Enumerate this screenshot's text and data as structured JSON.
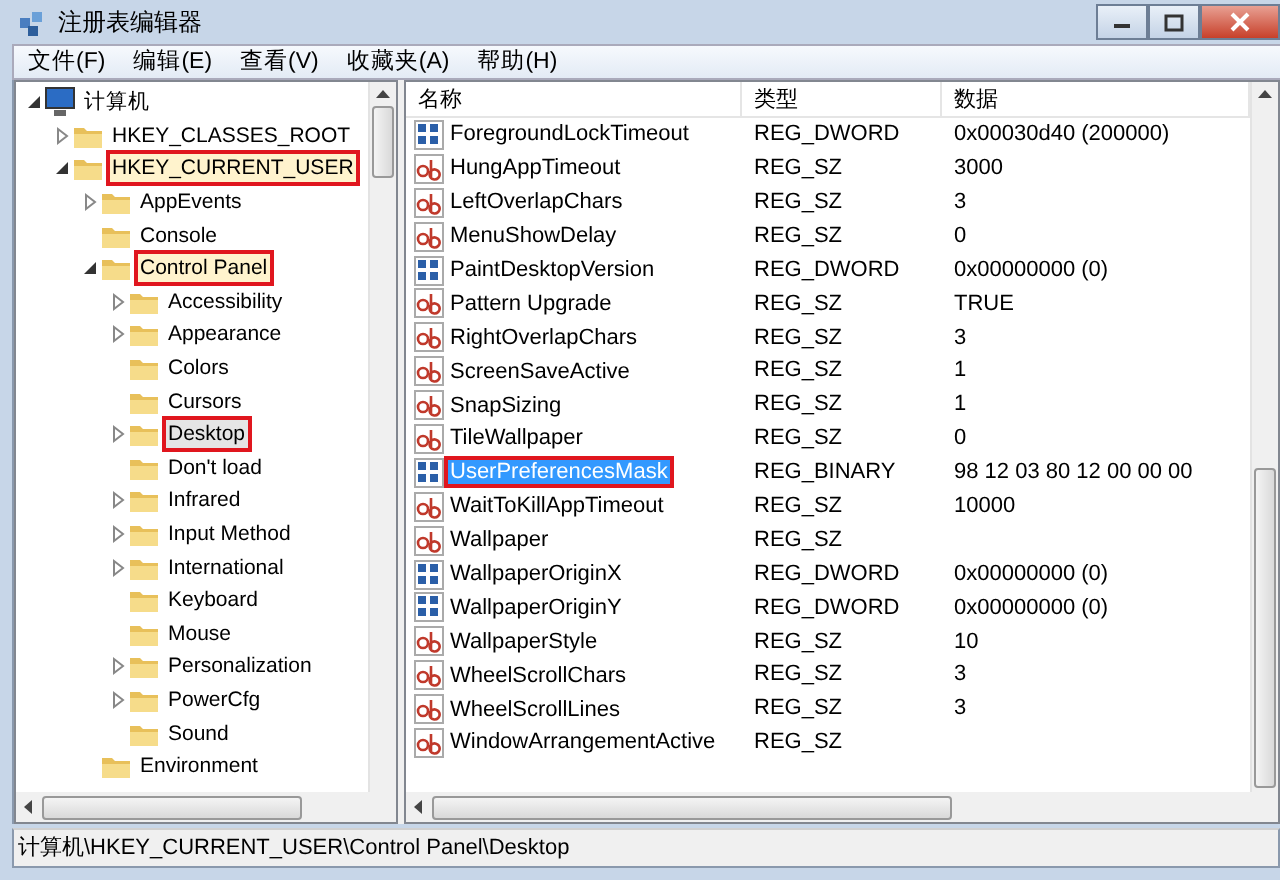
{
  "window": {
    "title": "注册表编辑器"
  },
  "menu": [
    "文件(F)",
    "编辑(E)",
    "查看(V)",
    "收藏夹(A)",
    "帮助(H)"
  ],
  "tree": [
    {
      "label": "计算机",
      "kind": "computer",
      "has_children": true,
      "expanded": true,
      "selected": false,
      "marked": false,
      "children": [
        {
          "label": "HKEY_CLASSES_ROOT",
          "kind": "folder",
          "has_children": true,
          "expanded": false,
          "selected": false,
          "marked": false
        },
        {
          "label": "HKEY_CURRENT_USER",
          "kind": "folder",
          "has_children": true,
          "expanded": true,
          "selected": false,
          "marked": true,
          "children": [
            {
              "label": "AppEvents",
              "kind": "folder",
              "has_children": true,
              "expanded": false,
              "selected": false,
              "marked": false
            },
            {
              "label": "Console",
              "kind": "folder",
              "has_children": false,
              "selected": false,
              "marked": false
            },
            {
              "label": "Control Panel",
              "kind": "folder",
              "has_children": true,
              "expanded": true,
              "selected": false,
              "marked": true,
              "children": [
                {
                  "label": "Accessibility",
                  "kind": "folder",
                  "has_children": true,
                  "expanded": false,
                  "selected": false,
                  "marked": false
                },
                {
                  "label": "Appearance",
                  "kind": "folder",
                  "has_children": true,
                  "expanded": false,
                  "selected": false,
                  "marked": false
                },
                {
                  "label": "Colors",
                  "kind": "folder",
                  "has_children": false,
                  "selected": false,
                  "marked": false
                },
                {
                  "label": "Cursors",
                  "kind": "folder",
                  "has_children": false,
                  "selected": false,
                  "marked": false
                },
                {
                  "label": "Desktop",
                  "kind": "folder",
                  "has_children": true,
                  "expanded": false,
                  "selected": true,
                  "marked": true
                },
                {
                  "label": "Don't load",
                  "kind": "folder",
                  "has_children": false,
                  "selected": false,
                  "marked": false
                },
                {
                  "label": "Infrared",
                  "kind": "folder",
                  "has_children": true,
                  "expanded": false,
                  "selected": false,
                  "marked": false
                },
                {
                  "label": "Input Method",
                  "kind": "folder",
                  "has_children": true,
                  "expanded": false,
                  "selected": false,
                  "marked": false
                },
                {
                  "label": "International",
                  "kind": "folder",
                  "has_children": true,
                  "expanded": false,
                  "selected": false,
                  "marked": false
                },
                {
                  "label": "Keyboard",
                  "kind": "folder",
                  "has_children": false,
                  "selected": false,
                  "marked": false
                },
                {
                  "label": "Mouse",
                  "kind": "folder",
                  "has_children": false,
                  "selected": false,
                  "marked": false
                },
                {
                  "label": "Personalization",
                  "kind": "folder",
                  "has_children": true,
                  "expanded": false,
                  "selected": false,
                  "marked": false
                },
                {
                  "label": "PowerCfg",
                  "kind": "folder",
                  "has_children": true,
                  "expanded": false,
                  "selected": false,
                  "marked": false
                },
                {
                  "label": "Sound",
                  "kind": "folder",
                  "has_children": false,
                  "selected": false,
                  "marked": false
                }
              ]
            },
            {
              "label": "Environment",
              "kind": "folder",
              "has_children": false,
              "selected": false,
              "marked": false
            }
          ]
        }
      ]
    }
  ],
  "table": {
    "columns": [
      "名称",
      "类型",
      "数据"
    ],
    "rows": [
      {
        "kind": "binary",
        "name": "ForegroundLockTimeout",
        "type": "REG_DWORD",
        "data": "0x00030d40 (200000)",
        "selected": false,
        "marked": false
      },
      {
        "kind": "string",
        "name": "HungAppTimeout",
        "type": "REG_SZ",
        "data": "3000",
        "selected": false,
        "marked": false
      },
      {
        "kind": "string",
        "name": "LeftOverlapChars",
        "type": "REG_SZ",
        "data": "3",
        "selected": false,
        "marked": false
      },
      {
        "kind": "string",
        "name": "MenuShowDelay",
        "type": "REG_SZ",
        "data": "0",
        "selected": false,
        "marked": false
      },
      {
        "kind": "binary",
        "name": "PaintDesktopVersion",
        "type": "REG_DWORD",
        "data": "0x00000000 (0)",
        "selected": false,
        "marked": false
      },
      {
        "kind": "string",
        "name": "Pattern Upgrade",
        "type": "REG_SZ",
        "data": "TRUE",
        "selected": false,
        "marked": false
      },
      {
        "kind": "string",
        "name": "RightOverlapChars",
        "type": "REG_SZ",
        "data": "3",
        "selected": false,
        "marked": false
      },
      {
        "kind": "string",
        "name": "ScreenSaveActive",
        "type": "REG_SZ",
        "data": "1",
        "selected": false,
        "marked": false
      },
      {
        "kind": "string",
        "name": "SnapSizing",
        "type": "REG_SZ",
        "data": "1",
        "selected": false,
        "marked": false
      },
      {
        "kind": "string",
        "name": "TileWallpaper",
        "type": "REG_SZ",
        "data": "0",
        "selected": false,
        "marked": false
      },
      {
        "kind": "binary",
        "name": "UserPreferencesMask",
        "type": "REG_BINARY",
        "data": "98 12 03 80 12 00 00 00",
        "selected": true,
        "marked": true
      },
      {
        "kind": "string",
        "name": "WaitToKillAppTimeout",
        "type": "REG_SZ",
        "data": "10000",
        "selected": false,
        "marked": false
      },
      {
        "kind": "string",
        "name": "Wallpaper",
        "type": "REG_SZ",
        "selected": false,
        "marked": false
      },
      {
        "kind": "binary",
        "name": "WallpaperOriginX",
        "type": "REG_DWORD",
        "data": "0x00000000 (0)",
        "selected": false,
        "marked": false
      },
      {
        "kind": "binary",
        "name": "WallpaperOriginY",
        "type": "REG_DWORD",
        "data": "0x00000000 (0)",
        "selected": false,
        "marked": false
      },
      {
        "kind": "string",
        "name": "WallpaperStyle",
        "type": "REG_SZ",
        "data": "10",
        "selected": false,
        "marked": false
      },
      {
        "kind": "string",
        "name": "WheelScrollChars",
        "type": "REG_SZ",
        "data": "3",
        "selected": false,
        "marked": false
      },
      {
        "kind": "string",
        "name": "WheelScrollLines",
        "type": "REG_SZ",
        "data": "3",
        "selected": false,
        "marked": false
      },
      {
        "kind": "string",
        "name": "WindowArrangementActive",
        "type": "REG_SZ",
        "selected": false,
        "marked": false
      }
    ]
  },
  "status_bar": "计算机\\HKEY_CURRENT_USER\\Control Panel\\Desktop"
}
